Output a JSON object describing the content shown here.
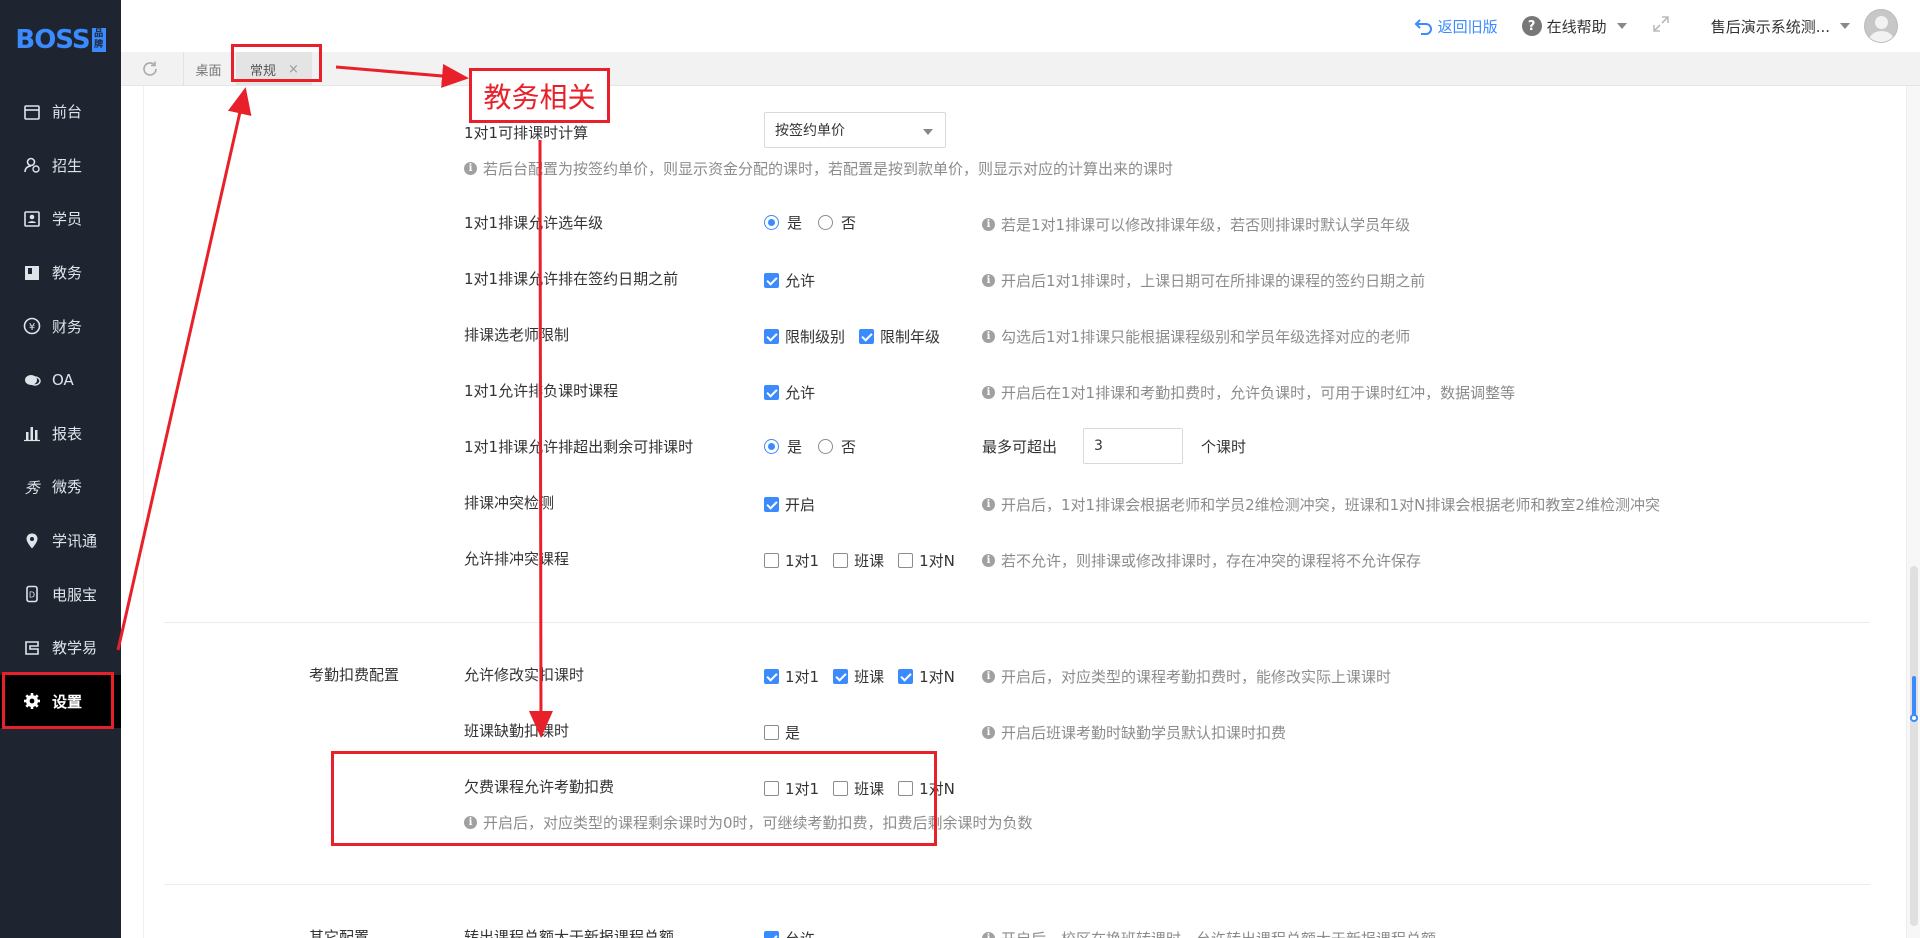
{
  "logo": {
    "text": "BOSS",
    "badge": "品牌"
  },
  "sidebar": {
    "items": [
      {
        "label": "前台",
        "icon": "calendar-icon"
      },
      {
        "label": "招生",
        "icon": "user-plus-icon"
      },
      {
        "label": "学员",
        "icon": "id-card-icon"
      },
      {
        "label": "教务",
        "icon": "book-icon"
      },
      {
        "label": "财务",
        "icon": "yen-icon"
      },
      {
        "label": "OA",
        "icon": "chat-icon"
      },
      {
        "label": "报表",
        "icon": "bar-chart-icon"
      },
      {
        "label": "微秀",
        "icon": "show-icon"
      },
      {
        "label": "学讯通",
        "icon": "pin-icon"
      },
      {
        "label": "电服宝",
        "icon": "phone-icon"
      },
      {
        "label": "教学易",
        "icon": "teach-icon"
      },
      {
        "label": "设置",
        "icon": "gear-icon",
        "active": true
      }
    ]
  },
  "header": {
    "back_old": "返回旧版",
    "help": "在线帮助",
    "user": "售后演示系统测..."
  },
  "tabs": {
    "desk": "桌面",
    "general": "常规",
    "close": "×"
  },
  "settings": {
    "r1": {
      "label": "1对1可排课时计算",
      "select": "按签约单价",
      "hint": "若后台配置为按签约单价，则显示资金分配的课时，若配置是按到款单价，则显示对应的计算出来的课时"
    },
    "r2": {
      "label": "1对1排课允许选年级",
      "yes": "是",
      "no": "否",
      "hint": "若是1对1排课可以修改排课年级，若否则排课时默认学员年级"
    },
    "r3": {
      "label": "1对1排课允许排在签约日期之前",
      "opt": "允许",
      "hint": "开启后1对1排课时，上课日期可在所排课的课程的签约日期之前"
    },
    "r4": {
      "label": "排课选老师限制",
      "opt1": "限制级别",
      "opt2": "限制年级",
      "hint": "勾选后1对1排课只能根据课程级别和学员年级选择对应的老师"
    },
    "r5": {
      "label": "1对1允许排负课时课程",
      "opt": "允许",
      "hint": "开启后在1对1排课和考勤扣费时，允许负课时，可用于课时红冲，数据调整等"
    },
    "r6": {
      "label": "1对1排课允许排超出剩余可排课时",
      "yes": "是",
      "no": "否",
      "extra_label": "最多可超出",
      "value": "3",
      "unit": "个课时"
    },
    "r7": {
      "label": "排课冲突检测",
      "opt": "开启",
      "hint": "开启后，1对1排课会根据老师和学员2维检测冲突，班课和1对N排课会根据老师和教室2维检测冲突"
    },
    "r8": {
      "label": "允许排冲突课程",
      "o1": "1对1",
      "o2": "班课",
      "o3": "1对N",
      "hint": "若不允许，则排课或修改排课时，存在冲突的课程将不允许保存"
    },
    "section2": "考勤扣费配置",
    "r9": {
      "label": "允许修改实扣课时",
      "o1": "1对1",
      "o2": "班课",
      "o3": "1对N",
      "hint": "开启后，对应类型的课程考勤扣费时，能修改实际上课课时"
    },
    "r10": {
      "label": "班课缺勤扣课时",
      "opt": "是",
      "hint": "开启后班课考勤时缺勤学员默认扣课时扣费"
    },
    "r11": {
      "label": "欠费课程允许考勤扣费",
      "o1": "1对1",
      "o2": "班课",
      "o3": "1对N",
      "hint": "开启后，对应类型的课程剩余课时为0时，可继续考勤扣费，扣费后剩余课时为负数"
    },
    "section3": "其它配置",
    "r12": {
      "label": "转出课程总额大于新报课程总额",
      "opt": "允许",
      "hint": "开启后，校区在换班转课时，允许转出课程总额大于新报课程总额"
    }
  },
  "annotation": {
    "label": "教务相关",
    "color": "#e8202a"
  },
  "colors": {
    "accent": "#3b8bff",
    "sidebar_bg": "#1f2530"
  }
}
